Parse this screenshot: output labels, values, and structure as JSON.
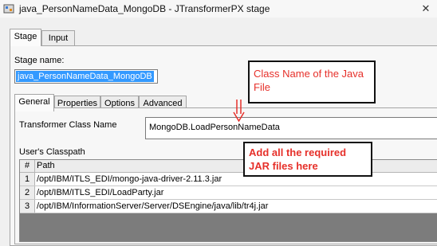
{
  "window": {
    "title": "java_PersonNameData_MongoDB - JTransformerPX stage",
    "close_glyph": "✕"
  },
  "top_tabs": [
    {
      "label": "Stage",
      "active": true
    },
    {
      "label": "Input",
      "active": false
    }
  ],
  "stage": {
    "name_label": "Stage name:",
    "name_value": "java_PersonNameData_MongoDB"
  },
  "inner_tabs": [
    {
      "label": "General",
      "active": true
    },
    {
      "label": "Properties",
      "active": false
    },
    {
      "label": "Options",
      "active": false
    },
    {
      "label": "Advanced",
      "active": false
    }
  ],
  "general": {
    "class_label": "Transformer Class Name",
    "class_value": "MongoDB.LoadPersonNameData",
    "classpath_label": "User's Classpath",
    "table": {
      "headers": [
        "#",
        "Path"
      ],
      "rows": [
        {
          "num": "1",
          "path": "/opt/IBM/ITLS_EDI/mongo-java-driver-2.11.3.jar"
        },
        {
          "num": "2",
          "path": "/opt/IBM/ITLS_EDI/LoadParty.jar"
        },
        {
          "num": "3",
          "path": "/opt/IBM/InformationServer/Server/DSEngine/java/lib/tr4j.jar"
        }
      ]
    }
  },
  "annotations": {
    "class_name_note": "Class Name of the Java File",
    "jar_note": "Add all the required JAR files here",
    "color": "#e6302a"
  },
  "icons": {
    "title": "stage-icon",
    "close": "close-icon",
    "arrow": "down-arrow-icon"
  }
}
